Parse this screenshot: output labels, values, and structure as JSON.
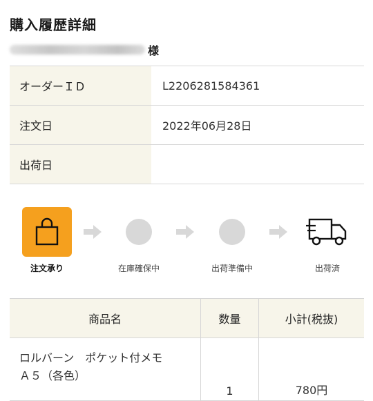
{
  "page": {
    "title": "購入履歴詳細",
    "customer_suffix": "様"
  },
  "order_info": [
    {
      "label": "オーダーＩＤ",
      "value": "L2206281584361"
    },
    {
      "label": "注文日",
      "value": "2022年06月28日"
    },
    {
      "label": "出荷日",
      "value": ""
    }
  ],
  "progress": {
    "steps": [
      {
        "label": "注文承り",
        "icon": "shopping-bag-icon",
        "state": "active"
      },
      {
        "label": "在庫確保中",
        "icon": "circle-icon",
        "state": "pending"
      },
      {
        "label": "出荷準備中",
        "icon": "circle-icon",
        "state": "pending"
      },
      {
        "label": "出荷済",
        "icon": "delivery-truck-icon",
        "state": "pending"
      }
    ]
  },
  "items_table": {
    "headers": [
      "商品名",
      "数量",
      "小計(税抜)"
    ],
    "rows": [
      {
        "name_line1": "ロルバーン　ポケット付メモ",
        "name_line2": "Ａ５（各色）",
        "qty": "1",
        "subtotal": "780円"
      }
    ]
  },
  "colors": {
    "accent": "#f5a01e",
    "header_bg": "#f7f5ea",
    "border": "#d6d6d6",
    "inactive": "#d8d8d8"
  }
}
